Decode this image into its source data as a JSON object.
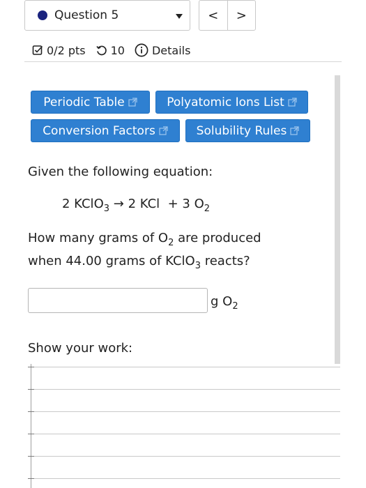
{
  "question_selector": {
    "label": "Question 5",
    "prev_symbol": "<",
    "next_symbol": ">"
  },
  "meta": {
    "score": "0/2 pts",
    "attempts": "10",
    "details": "Details"
  },
  "resources": {
    "periodic_table": "Periodic Table",
    "polyatomic_ions": "Polyatomic Ions List",
    "conversion_factors": "Conversion Factors",
    "solubility_rules": "Solubility Rules"
  },
  "question": {
    "intro": "Given the following equation:",
    "equation": {
      "lhs_coef": "2 KClO",
      "lhs_sub": "3",
      "arrow": "→",
      "rhs1": "2 KCl",
      "plus": "+ 3 O",
      "rhs2_sub": "2"
    },
    "line1_pre": "How many grams of O",
    "line1_sub": "2",
    "line1_post": " are produced",
    "line2_pre": "when 44.00 grams of KClO",
    "line2_sub": "3",
    "line2_post": " reacts?"
  },
  "answer": {
    "value": "",
    "unit_pre": "g O",
    "unit_sub": "2"
  },
  "work": {
    "label": "Show your work:"
  },
  "colors": {
    "accent": "#2f80d1",
    "dot": "#1a237e"
  }
}
